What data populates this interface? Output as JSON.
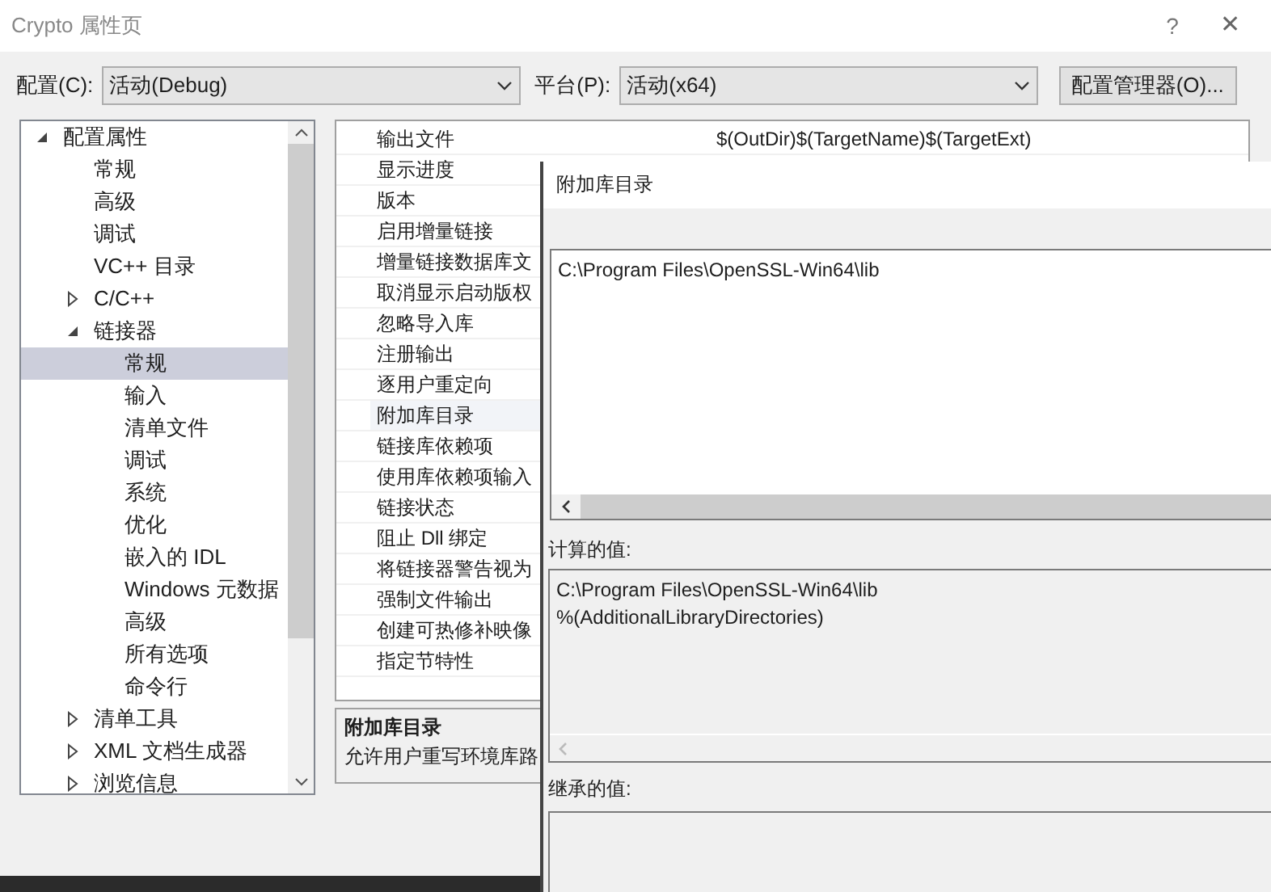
{
  "window": {
    "title": "Crypto 属性页",
    "help": "?",
    "close": "✕"
  },
  "config": {
    "label": "配置(C):",
    "value": "活动(Debug)"
  },
  "platform": {
    "label": "平台(P):",
    "value": "活动(x64)"
  },
  "config_manager_button": "配置管理器(O)...",
  "tree": [
    {
      "label": "配置属性",
      "expanded": true,
      "selected": false,
      "children": [
        {
          "label": "常规",
          "selected": false
        },
        {
          "label": "高级",
          "selected": false
        },
        {
          "label": "调试",
          "selected": false
        },
        {
          "label": "VC++ 目录",
          "selected": false
        },
        {
          "label": "C/C++",
          "expanded": false,
          "selected": false
        },
        {
          "label": "链接器",
          "expanded": true,
          "selected": false,
          "children": [
            {
              "label": "常规",
              "selected": true
            },
            {
              "label": "输入",
              "selected": false
            },
            {
              "label": "清单文件",
              "selected": false
            },
            {
              "label": "调试",
              "selected": false
            },
            {
              "label": "系统",
              "selected": false
            },
            {
              "label": "优化",
              "selected": false
            },
            {
              "label": "嵌入的 IDL",
              "selected": false
            },
            {
              "label": "Windows 元数据",
              "selected": false
            },
            {
              "label": "高级",
              "selected": false
            },
            {
              "label": "所有选项",
              "selected": false
            },
            {
              "label": "命令行",
              "selected": false
            }
          ]
        },
        {
          "label": "清单工具",
          "expanded": false,
          "selected": false
        },
        {
          "label": "XML 文档生成器",
          "expanded": false,
          "selected": false
        },
        {
          "label": "浏览信息",
          "expanded": false,
          "selected": false
        }
      ]
    }
  ],
  "properties": [
    {
      "name": "输出文件",
      "value": "$(OutDir)$(TargetName)$(TargetExt)",
      "selected": false
    },
    {
      "name": "显示进度",
      "selected": false
    },
    {
      "name": "版本",
      "selected": false
    },
    {
      "name": "启用增量链接",
      "selected": false
    },
    {
      "name": "增量链接数据库文",
      "selected": false
    },
    {
      "name": "取消显示启动版权",
      "selected": false
    },
    {
      "name": "忽略导入库",
      "selected": false
    },
    {
      "name": "注册输出",
      "selected": false
    },
    {
      "name": "逐用户重定向",
      "selected": false
    },
    {
      "name": "附加库目录",
      "selected": true
    },
    {
      "name": "链接库依赖项",
      "selected": false
    },
    {
      "name": "使用库依赖项输入",
      "selected": false
    },
    {
      "name": "链接状态",
      "selected": false
    },
    {
      "name": "阻止 Dll 绑定",
      "selected": false
    },
    {
      "name": "将链接器警告视为",
      "selected": false
    },
    {
      "name": "强制文件输出",
      "selected": false
    },
    {
      "name": "创建可热修补映像",
      "selected": false
    },
    {
      "name": "指定节特性",
      "selected": false
    }
  ],
  "description": {
    "title": "附加库目录",
    "text": "允许用户重写环境库路"
  },
  "dialog": {
    "title": "附加库目录",
    "value": "C:\\Program Files\\OpenSSL-Win64\\lib",
    "computed_label": "计算的值:",
    "computed_lines": [
      "C:\\Program Files\\OpenSSL-Win64\\lib",
      "%(AdditionalLibraryDirectories)"
    ],
    "inherited_label": "继承的值:"
  }
}
